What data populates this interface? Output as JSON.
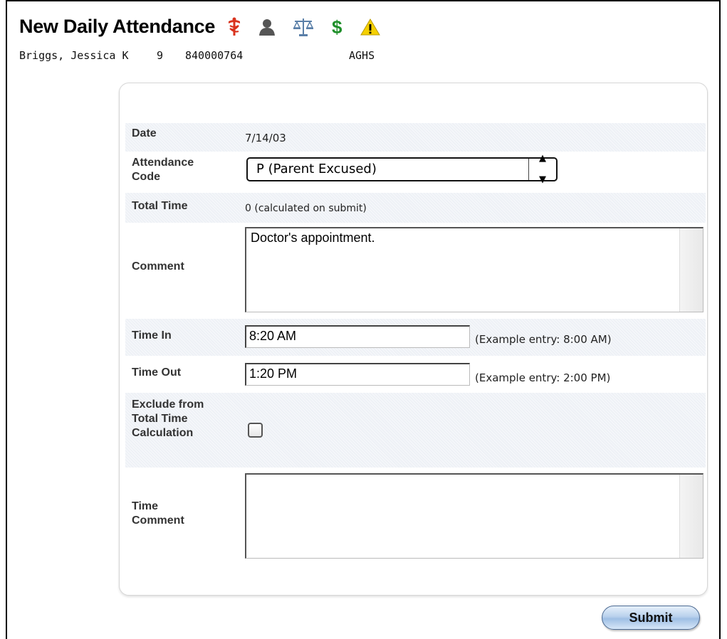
{
  "page": {
    "title": "New Daily Attendance",
    "icons": [
      "medical-icon",
      "person-icon",
      "scales-icon",
      "dollar-icon",
      "warning-icon"
    ]
  },
  "student": {
    "name": "Briggs, Jessica K",
    "grade": "9",
    "id": "840000764",
    "school": "AGHS"
  },
  "form": {
    "date_label": "Date",
    "date_value": "7/14/03",
    "code_label": "Attendance Code",
    "code_value": "P (Parent Excused)",
    "total_label": "Total Time",
    "total_value": "0 (calculated on submit)",
    "comment_label": "Comment",
    "comment_value": "Doctor's appointment.",
    "time_in_label": "Time In",
    "time_in_value": "8:20 AM",
    "time_in_hint": "(Example entry: 8:00 AM)",
    "time_out_label": "Time Out",
    "time_out_value": "1:20 PM",
    "time_out_hint": "(Example entry: 2:00 PM)",
    "exclude_label": "Exclude from Total Time Calculation",
    "exclude_checked": false,
    "time_comment_label": "Time Comment",
    "time_comment_value": ""
  },
  "actions": {
    "submit_label": "Submit"
  },
  "colors": {
    "row_shade": "#eef1f6",
    "medical": "#d9331e",
    "dollar": "#1f8f2a",
    "warning": "#f5d000"
  }
}
